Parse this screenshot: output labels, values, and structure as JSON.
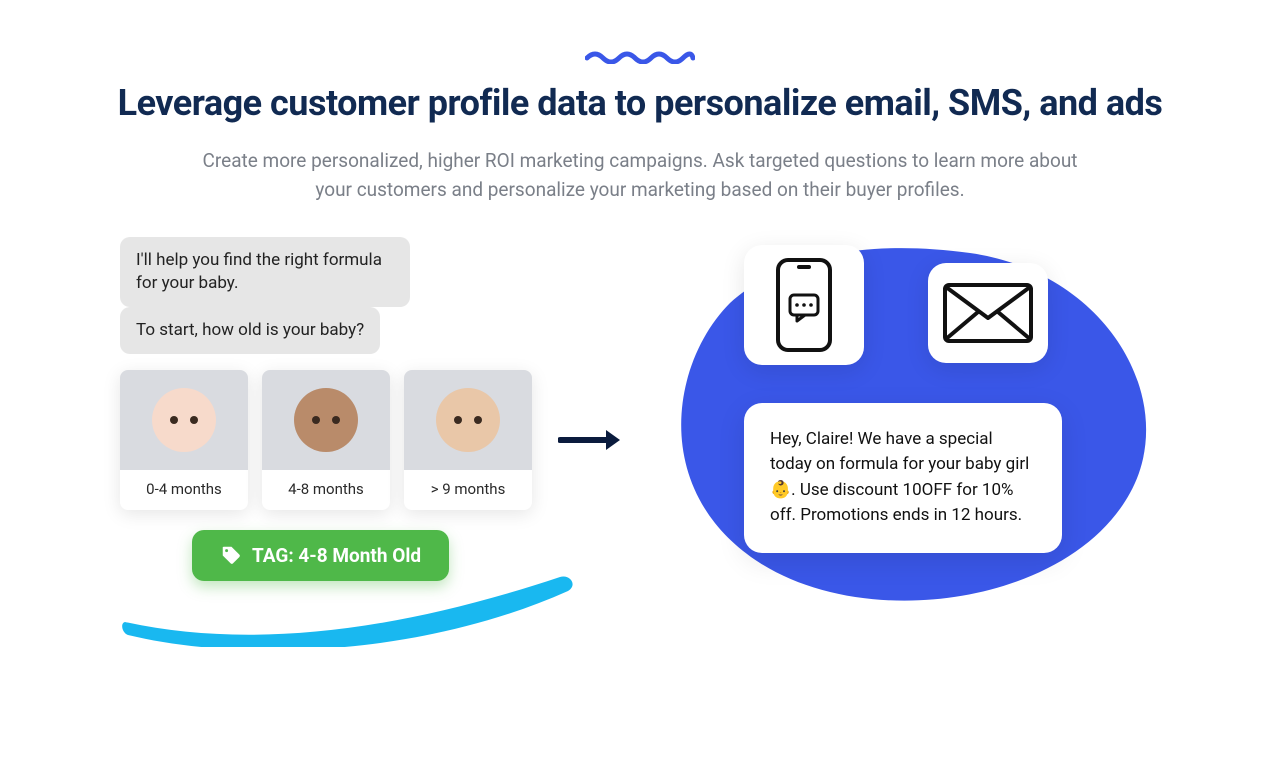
{
  "heading": "Leverage customer profile data to personalize email, SMS, and ads",
  "subtitle": "Create more personalized, higher ROI marketing campaigns. Ask targeted questions to learn more about your customers and personalize your marketing based on their buyer profiles.",
  "chat": {
    "msg1": "I'll help you find the right formula for your baby.",
    "msg2": "To start, how old is your baby?"
  },
  "options": [
    {
      "label": "0-4 months"
    },
    {
      "label": "4-8 months"
    },
    {
      "label": "> 9 months"
    }
  ],
  "tag_label": "TAG: 4-8 Month Old",
  "promo_message": "Hey, Claire! We have a special today on formula for your baby girl 👶. Use discount 10OFF for 10% off. Promotions ends in 12 hours.",
  "colors": {
    "brand_blue": "#3a57e8",
    "dark_navy": "#112a52",
    "cyan_swoosh": "#19b8f0",
    "tag_green": "#4fb849"
  }
}
